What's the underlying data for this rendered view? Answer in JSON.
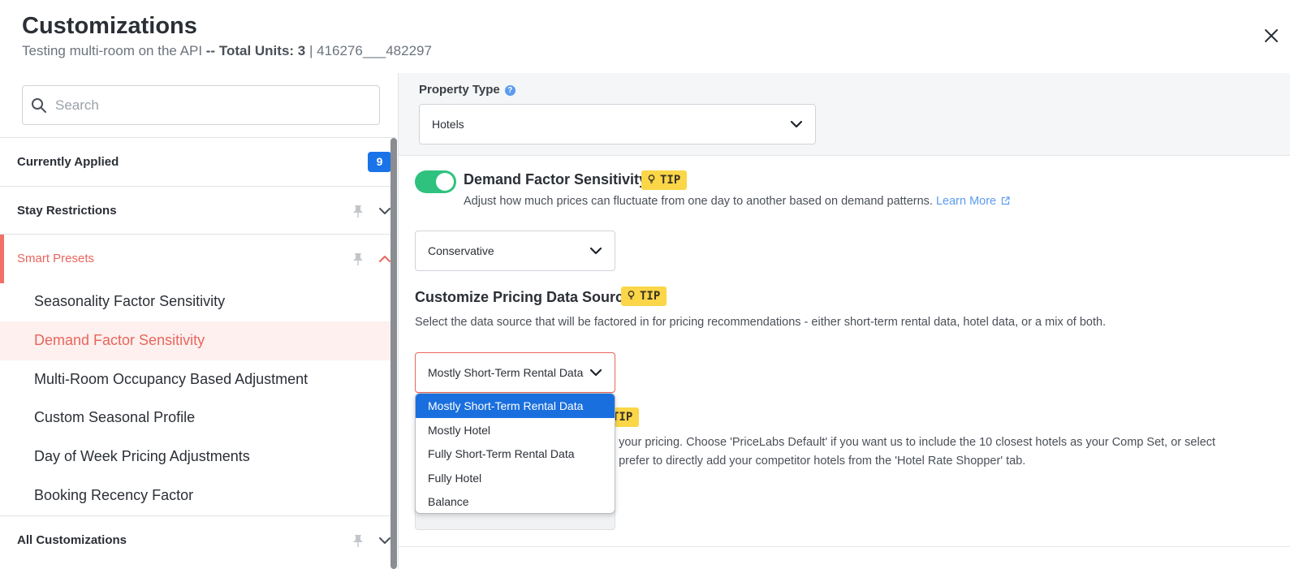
{
  "header": {
    "title": "Customizations",
    "listing_name": "Testing multi-room on the API",
    "separator": " -- ",
    "total_units_label": "Total Units: 3",
    "listing_id": " | 416276___482297"
  },
  "sidebar": {
    "search_placeholder": "Search",
    "currently_applied": {
      "label": "Currently Applied",
      "count": "9"
    },
    "stay_restrictions": {
      "label": "Stay Restrictions"
    },
    "smart_presets": {
      "label": "Smart Presets",
      "items": [
        {
          "label": "Seasonality Factor Sensitivity"
        },
        {
          "label": "Demand Factor Sensitivity"
        },
        {
          "label": "Multi-Room Occupancy Based Adjustment"
        },
        {
          "label": "Custom Seasonal Profile"
        },
        {
          "label": "Day of Week Pricing Adjustments"
        },
        {
          "label": "Booking Recency Factor"
        }
      ]
    },
    "all_customizations": {
      "label": "All Customizations"
    }
  },
  "main": {
    "property_type": {
      "label": "Property Type",
      "help": "?",
      "value": "Hotels"
    },
    "demand_factor": {
      "title": "Demand Factor Sensitivity",
      "tip": "TIP",
      "enabled": true,
      "description": "Adjust how much prices can fluctuate from one day to another based on demand patterns.",
      "learn_more": "Learn More",
      "value": "Conservative"
    },
    "pricing_source": {
      "title": "Customize Pricing Data Source",
      "tip": "TIP",
      "description": "Select the data source that will be factored in for pricing recommendations - either short-term rental data, hotel data, or a mix of both.",
      "value": "Mostly Short-Term Rental Data",
      "options": [
        "Mostly Short-Term Rental Data",
        "Mostly Hotel",
        "Fully Short-Term Rental Data",
        "Fully Hotel",
        "Balance"
      ]
    },
    "comp_set": {
      "tip": "TIP",
      "line1": "e your pricing. Choose 'PriceLabs Default' if you want us to include the 10 closest hotels as your Comp Set, or select",
      "line2": "u prefer to directly add your competitor hotels from the 'Hotel Rate Shopper' tab."
    }
  },
  "colors": {
    "accent": "#e9655c",
    "primary": "#1a73e8",
    "toggle_on": "#2ec27e",
    "tip": "#fad648"
  }
}
